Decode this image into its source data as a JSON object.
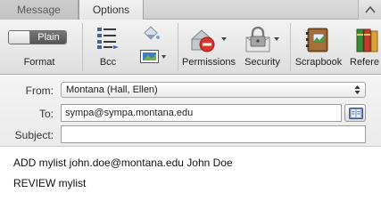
{
  "tabs": [
    {
      "label": "Message",
      "active": false
    },
    {
      "label": "Options",
      "active": true
    }
  ],
  "ribbon": {
    "format": {
      "toggle_label": "Plain",
      "label": "Format"
    },
    "bcc": {
      "label": "Bcc"
    },
    "permissions": {
      "label": "Permissions"
    },
    "security": {
      "label": "Security"
    },
    "scrapbook": {
      "label": "Scrapbook"
    },
    "reference": {
      "label": "Refere"
    }
  },
  "fields": {
    "from": {
      "label": "From:",
      "value": "Montana (Hall, Ellen)"
    },
    "to": {
      "label": "To:",
      "value": "sympa@sympa.montana.edu"
    },
    "subject": {
      "label": "Subject:",
      "value": ""
    }
  },
  "body": {
    "lines": [
      "ADD mylist john.doe@montana.edu John Doe",
      "REVIEW mylist"
    ]
  },
  "colors": {
    "accent_red": "#d9362b",
    "toggle_dark": "#5f5f5f"
  }
}
